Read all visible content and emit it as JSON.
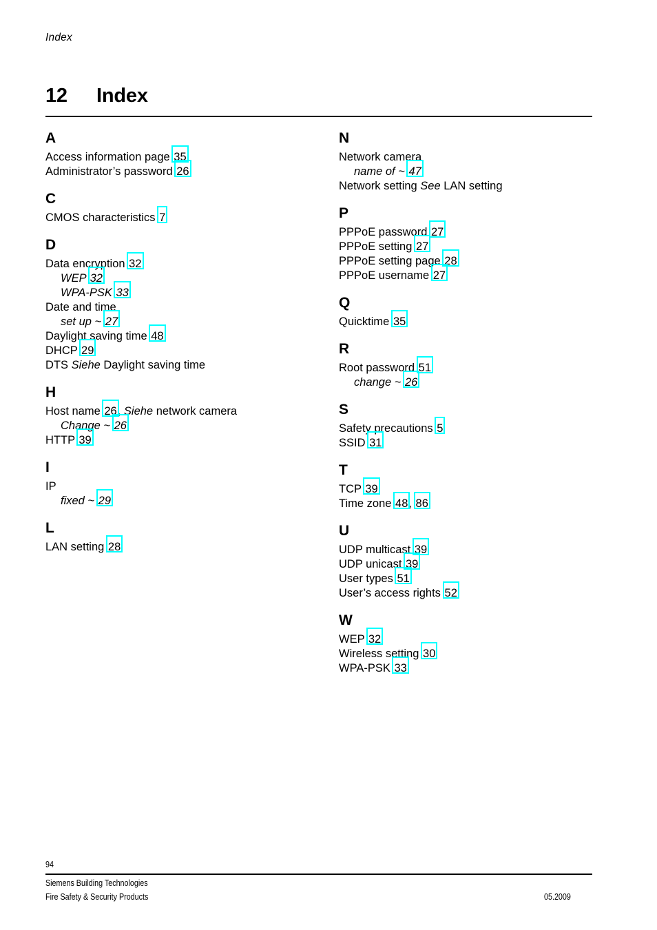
{
  "running_head": "Index",
  "chapter": {
    "number": "12",
    "title": "Index"
  },
  "footer": {
    "page_number": "94",
    "company_line_1": "Siemens Building Technologies",
    "company_line_2": "Fire Safety & Security Products",
    "date": "05.2009"
  },
  "colors": {
    "link_box": "#00ffff",
    "text": "#000000",
    "background": "#ffffff"
  },
  "columns": [
    {
      "id": "left",
      "groups": [
        {
          "letter": "A",
          "entries": [
            {
              "parts": [
                {
                  "t": "text",
                  "v": "Access information page "
                },
                {
                  "t": "page",
                  "v": "35"
                }
              ]
            },
            {
              "parts": [
                {
                  "t": "text",
                  "v": "Administrator’s password "
                },
                {
                  "t": "page",
                  "v": "26"
                }
              ]
            }
          ]
        },
        {
          "letter": "C",
          "entries": [
            {
              "parts": [
                {
                  "t": "text",
                  "v": "CMOS characteristics "
                },
                {
                  "t": "page",
                  "v": "7"
                }
              ]
            }
          ]
        },
        {
          "letter": "D",
          "entries": [
            {
              "parts": [
                {
                  "t": "text",
                  "v": "Data encryption "
                },
                {
                  "t": "page",
                  "v": "32"
                }
              ]
            },
            {
              "sub": true,
              "parts": [
                {
                  "t": "text",
                  "v": "WEP "
                },
                {
                  "t": "page",
                  "v": "32"
                }
              ]
            },
            {
              "sub": true,
              "parts": [
                {
                  "t": "text",
                  "v": "WPA-PSK "
                },
                {
                  "t": "page",
                  "v": "33"
                }
              ]
            },
            {
              "parts": [
                {
                  "t": "text",
                  "v": "Date and time"
                }
              ]
            },
            {
              "sub": true,
              "parts": [
                {
                  "t": "text",
                  "v": "set up ~ "
                },
                {
                  "t": "page",
                  "v": "27"
                }
              ]
            },
            {
              "parts": [
                {
                  "t": "text",
                  "v": "Daylight saving time "
                },
                {
                  "t": "page",
                  "v": "48"
                }
              ]
            },
            {
              "parts": [
                {
                  "t": "text",
                  "v": "DHCP "
                },
                {
                  "t": "page",
                  "v": "29"
                }
              ]
            },
            {
              "parts": [
                {
                  "t": "text",
                  "v": "DTS  "
                },
                {
                  "t": "italic",
                  "v": "Siehe"
                },
                {
                  "t": "text",
                  "v": " Daylight saving time"
                }
              ]
            }
          ]
        },
        {
          "letter": "H",
          "entries": [
            {
              "parts": [
                {
                  "t": "text",
                  "v": "Host name "
                },
                {
                  "t": "page",
                  "v": "26"
                },
                {
                  "t": "text",
                  "v": ", "
                },
                {
                  "t": "italic",
                  "v": "Siehe"
                },
                {
                  "t": "text",
                  "v": " network camera"
                }
              ]
            },
            {
              "sub": true,
              "parts": [
                {
                  "t": "text",
                  "v": "Change ~ "
                },
                {
                  "t": "page",
                  "v": "26"
                }
              ]
            },
            {
              "parts": [
                {
                  "t": "text",
                  "v": "HTTP "
                },
                {
                  "t": "page",
                  "v": "39"
                }
              ]
            }
          ]
        },
        {
          "letter": "I",
          "entries": [
            {
              "parts": [
                {
                  "t": "text",
                  "v": "IP"
                }
              ]
            },
            {
              "sub": true,
              "parts": [
                {
                  "t": "text",
                  "v": "fixed  ~ "
                },
                {
                  "t": "page",
                  "v": "29"
                }
              ]
            }
          ]
        },
        {
          "letter": "L",
          "entries": [
            {
              "parts": [
                {
                  "t": "text",
                  "v": "LAN setting "
                },
                {
                  "t": "page",
                  "v": "28"
                }
              ]
            }
          ]
        }
      ]
    },
    {
      "id": "right",
      "groups": [
        {
          "letter": "N",
          "entries": [
            {
              "parts": [
                {
                  "t": "text",
                  "v": "Network camera"
                }
              ]
            },
            {
              "sub": true,
              "parts": [
                {
                  "t": "text",
                  "v": "name of ~ "
                },
                {
                  "t": "page",
                  "v": "47"
                }
              ]
            },
            {
              "parts": [
                {
                  "t": "text",
                  "v": "Network setting  "
                },
                {
                  "t": "italic",
                  "v": "See"
                },
                {
                  "t": "text",
                  "v": " LAN setting"
                }
              ]
            }
          ]
        },
        {
          "letter": "P",
          "entries": [
            {
              "parts": [
                {
                  "t": "text",
                  "v": "PPPoE password "
                },
                {
                  "t": "page",
                  "v": "27"
                }
              ]
            },
            {
              "parts": [
                {
                  "t": "text",
                  "v": "PPPoE setting "
                },
                {
                  "t": "page",
                  "v": "27"
                }
              ]
            },
            {
              "parts": [
                {
                  "t": "text",
                  "v": "PPPoE setting page "
                },
                {
                  "t": "page",
                  "v": "28"
                }
              ]
            },
            {
              "parts": [
                {
                  "t": "text",
                  "v": "PPPoE username "
                },
                {
                  "t": "page",
                  "v": "27"
                }
              ]
            }
          ]
        },
        {
          "letter": "Q",
          "entries": [
            {
              "parts": [
                {
                  "t": "text",
                  "v": "Quicktime "
                },
                {
                  "t": "page",
                  "v": "35"
                }
              ]
            }
          ]
        },
        {
          "letter": "R",
          "entries": [
            {
              "parts": [
                {
                  "t": "text",
                  "v": "Root password "
                },
                {
                  "t": "page",
                  "v": "51"
                }
              ]
            },
            {
              "sub": true,
              "parts": [
                {
                  "t": "text",
                  "v": "change ~ "
                },
                {
                  "t": "page",
                  "v": "26"
                }
              ]
            }
          ]
        },
        {
          "letter": "S",
          "entries": [
            {
              "parts": [
                {
                  "t": "text",
                  "v": "Safety precautions "
                },
                {
                  "t": "page",
                  "v": "5"
                }
              ]
            },
            {
              "parts": [
                {
                  "t": "text",
                  "v": "SSID "
                },
                {
                  "t": "page",
                  "v": "31"
                }
              ]
            }
          ]
        },
        {
          "letter": "T",
          "entries": [
            {
              "parts": [
                {
                  "t": "text",
                  "v": "TCP "
                },
                {
                  "t": "page",
                  "v": "39"
                }
              ]
            },
            {
              "parts": [
                {
                  "t": "text",
                  "v": "Time zone "
                },
                {
                  "t": "page",
                  "v": "48"
                },
                {
                  "t": "text",
                  "v": ", "
                },
                {
                  "t": "page",
                  "v": "86"
                }
              ]
            }
          ]
        },
        {
          "letter": "U",
          "entries": [
            {
              "parts": [
                {
                  "t": "text",
                  "v": "UDP multicast "
                },
                {
                  "t": "page",
                  "v": "39"
                }
              ]
            },
            {
              "parts": [
                {
                  "t": "text",
                  "v": "UDP unicast "
                },
                {
                  "t": "page",
                  "v": "39"
                }
              ]
            },
            {
              "parts": [
                {
                  "t": "text",
                  "v": "User types "
                },
                {
                  "t": "page",
                  "v": "51"
                }
              ]
            },
            {
              "parts": [
                {
                  "t": "text",
                  "v": "User’s access rights "
                },
                {
                  "t": "page",
                  "v": "52"
                }
              ]
            }
          ]
        },
        {
          "letter": "W",
          "entries": [
            {
              "parts": [
                {
                  "t": "text",
                  "v": "WEP "
                },
                {
                  "t": "page",
                  "v": "32"
                }
              ]
            },
            {
              "parts": [
                {
                  "t": "text",
                  "v": "Wireless setting "
                },
                {
                  "t": "page",
                  "v": "30"
                }
              ]
            },
            {
              "parts": [
                {
                  "t": "text",
                  "v": "WPA-PSK "
                },
                {
                  "t": "page",
                  "v": "33"
                }
              ]
            }
          ]
        }
      ]
    }
  ]
}
